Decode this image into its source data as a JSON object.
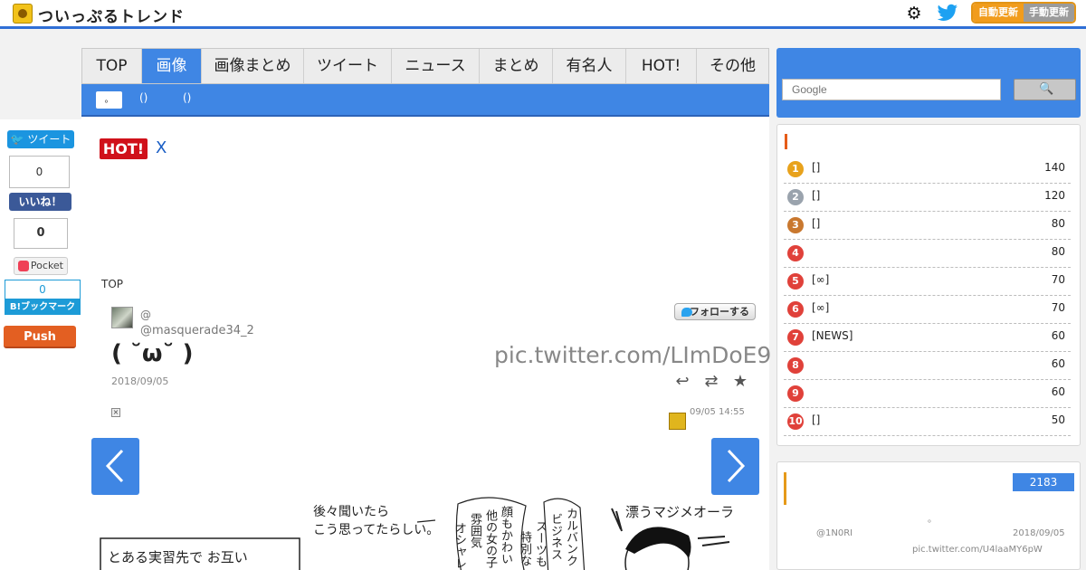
{
  "header": {
    "site_title": "ついっぷるトレンド",
    "auto_update": "自動更新",
    "manual_update": "手動更新"
  },
  "share": {
    "tweet_label": "ツイート",
    "fb_count": "0",
    "fb_label": "いいね！",
    "pocket_count": "0",
    "pocket_label": "Pocket",
    "hatena_count": "0",
    "hatena_label": "B!ブックマーク",
    "push_label": "Push"
  },
  "nav": {
    "tabs": [
      "TOP",
      "画像",
      "画像まとめ",
      "ツイート",
      "ニュース",
      "まとめ",
      "有名人",
      "HOT!",
      "その他"
    ],
    "active_index": 1,
    "sub_select": "。",
    "sub_items": [
      "()",
      "()"
    ]
  },
  "hot": {
    "badge": "HOT!",
    "title": "X"
  },
  "breadcrumb": "TOP",
  "tweet": {
    "at_prefix": "@",
    "handle": "@masquerade34_2",
    "follow_label": "フォローする",
    "text": "( ˘ω˘ )",
    "pic_link": "pic.twitter.com/LImDoE9",
    "date": "2018/09/05",
    "sub_time": "09/05 14:55"
  },
  "comic": {
    "lines": [
      "後々聞いたら",
      "こう思ってたらしい。",
      "とある実習先で お互い",
      "漂うマジメオーラ",
      "カルバンク",
      "ビジネス",
      "スーツも",
      "特別な",
      "顔もかわい",
      "他の女の子",
      "雰囲気",
      "オシャレ"
    ]
  },
  "search": {
    "placeholder": "Google"
  },
  "ranking": [
    {
      "rank": "1",
      "title": "[]",
      "count": "140",
      "color": "#e8a21c"
    },
    {
      "rank": "2",
      "title": "[]",
      "count": "120",
      "color": "#9aa3ad"
    },
    {
      "rank": "3",
      "title": "[]",
      "count": "80",
      "color": "#c9782f"
    },
    {
      "rank": "4",
      "title": "",
      "count": "80",
      "color": "#e0413a"
    },
    {
      "rank": "5",
      "title": "[∞]",
      "count": "70",
      "color": "#e0413a"
    },
    {
      "rank": "6",
      "title": "[∞]",
      "count": "70",
      "color": "#e0413a"
    },
    {
      "rank": "7",
      "title": "[NEWS]",
      "count": "60",
      "color": "#e0413a"
    },
    {
      "rank": "8",
      "title": "",
      "count": "60",
      "color": "#e0413a"
    },
    {
      "rank": "9",
      "title": "",
      "count": "60",
      "color": "#e0413a"
    },
    {
      "rank": "10",
      "title": "[]",
      "count": "50",
      "color": "#e0413a"
    }
  ],
  "box2": {
    "count": "2183",
    "dot": "。",
    "user": "@1N0RI",
    "date": "2018/09/05",
    "link": "pic.twitter.com/U4laaMY6pW"
  }
}
